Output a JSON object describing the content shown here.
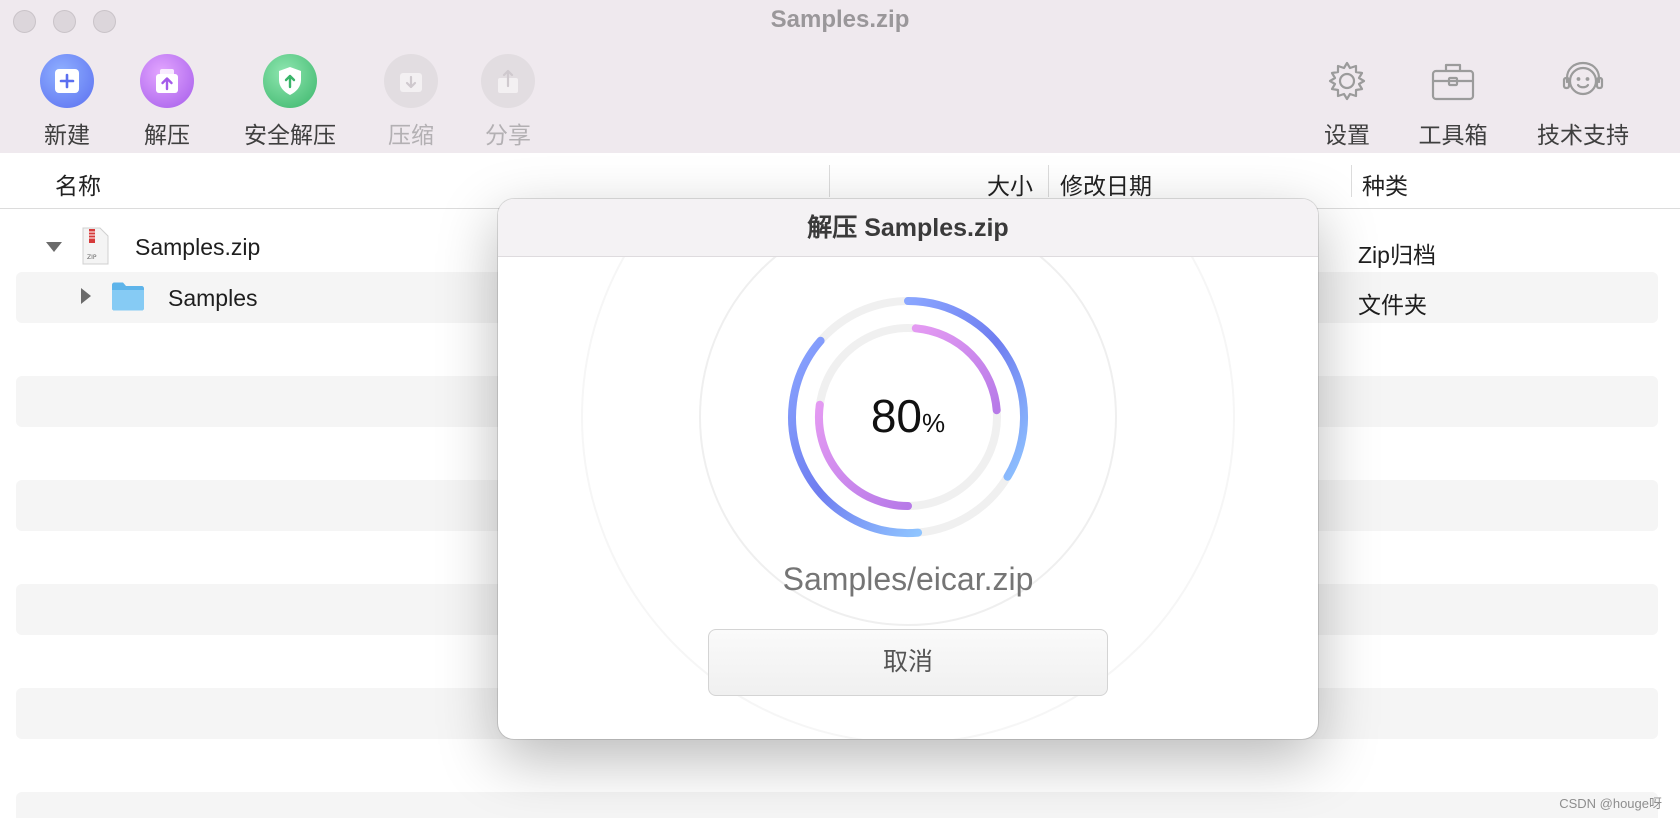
{
  "window": {
    "title": "Samples.zip"
  },
  "toolbar": {
    "new_label": "新建",
    "extract_label": "解压",
    "safe_extract_label": "安全解压",
    "compress_label": "压缩",
    "share_label": "分享",
    "settings_label": "设置",
    "toolbox_label": "工具箱",
    "support_label": "技术支持"
  },
  "columns": {
    "name": "名称",
    "size": "大小",
    "modified": "修改日期",
    "kind": "种类"
  },
  "files": [
    {
      "name": "Samples.zip",
      "kind": "Zip归档"
    },
    {
      "name": "Samples",
      "kind": "文件夹"
    }
  ],
  "dialog": {
    "title": "解压 Samples.zip",
    "percent_value": "80",
    "percent_symbol": "%",
    "progress": 0.8,
    "current_file": "Samples/eicar.zip",
    "cancel_label": "取消"
  },
  "watermark": "CSDN @houge呀",
  "colors": {
    "blue_accent": "#6f8cf0",
    "purple_accent": "#c17ae6",
    "green_accent": "#4cc27a",
    "chrome_bg": "#efe9ee"
  }
}
